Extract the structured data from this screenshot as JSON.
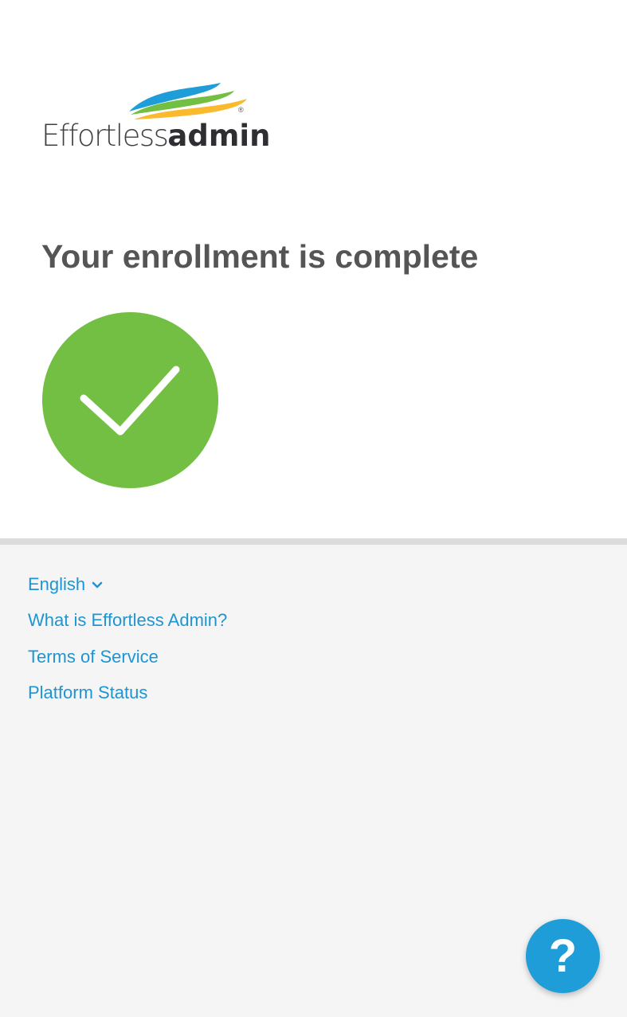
{
  "brand": {
    "name_light": "Effortless",
    "name_bold": "admin",
    "registered_mark": "®",
    "colors": {
      "blue": "#1e9dd8",
      "green": "#72bf44",
      "yellow": "#fbb92e"
    }
  },
  "main": {
    "heading": "Your enrollment is complete",
    "status_icon": "checkmark-circle-icon",
    "status_color": "#72bf44"
  },
  "footer": {
    "language": {
      "label": "English",
      "icon": "chevron-down-icon"
    },
    "links": [
      {
        "label": "What is Effortless Admin?"
      },
      {
        "label": "Terms of Service"
      },
      {
        "label": "Platform Status"
      }
    ],
    "link_color": "#1e95d3"
  },
  "help_button": {
    "label": "?",
    "icon": "help-icon",
    "color": "#1e9dd8"
  }
}
